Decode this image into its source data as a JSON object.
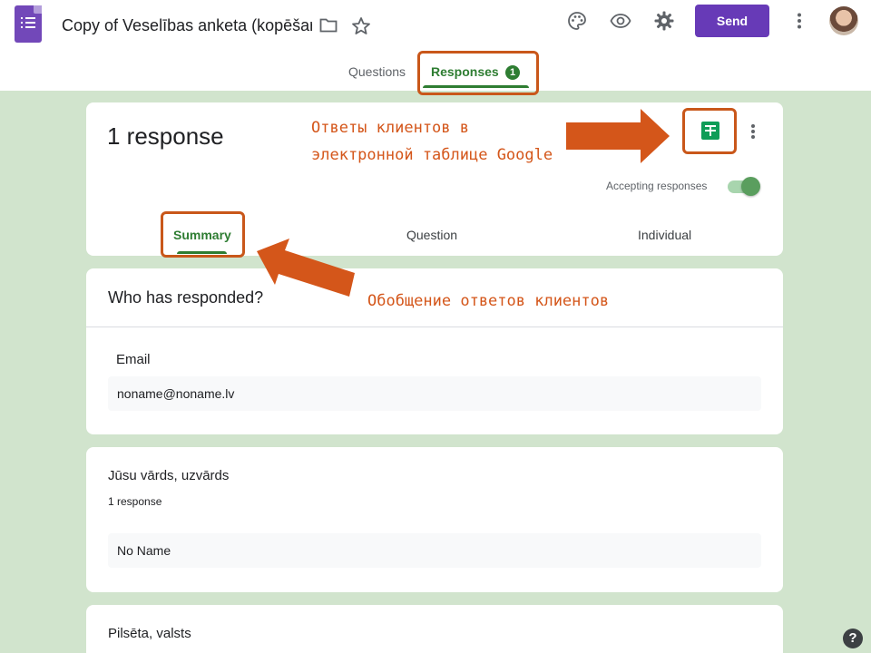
{
  "header": {
    "doc_title": "Copy of Veselības anketa (kopēšar",
    "send_label": "Send",
    "tabs": [
      {
        "label": "Questions"
      },
      {
        "label": "Responses",
        "badge": "1"
      }
    ]
  },
  "icons": {
    "app": "google-forms-icon",
    "folder": "folder-icon",
    "star": "star-icon",
    "palette": "palette-icon",
    "preview": "eye-icon",
    "settings": "gear-icon",
    "more": "more-vert-icon",
    "sheets": "google-sheets-icon",
    "help": "help-icon"
  },
  "summary_card": {
    "title": "1 response",
    "accepting_label": "Accepting responses",
    "accepting_on": true,
    "tabs": [
      "Summary",
      "Question",
      "Individual"
    ]
  },
  "who_card": {
    "title": "Who has responded?",
    "field_label": "Email",
    "value": "noname@noname.lv"
  },
  "question1": {
    "title": "Jūsu vārds, uzvārds",
    "count": "1 response",
    "answer": "No Name"
  },
  "question2": {
    "title": "Pilsēta, valsts"
  },
  "annotations": {
    "sheets_note_line1": "Ответы клиентов в",
    "sheets_note_line2": "электронной таблице Google",
    "summary_note": "Обобщение ответов клиентов"
  },
  "help_label": "?",
  "colors": {
    "accent_green": "#2e7d32",
    "send_purple": "#673ab7",
    "annotation_orange": "#d4561a",
    "background": "#d1e4cd"
  }
}
